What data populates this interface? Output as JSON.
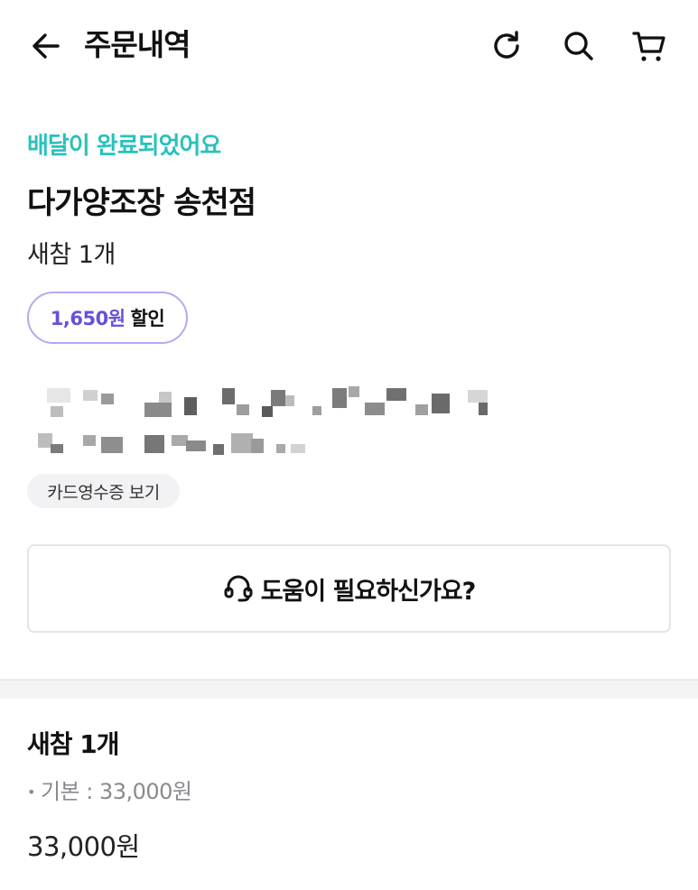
{
  "header": {
    "title": "주문내역",
    "icons": {
      "back": "arrow-left-icon",
      "refresh": "refresh-icon",
      "search": "search-icon",
      "cart": "cart-icon"
    }
  },
  "order": {
    "status": "배달이 완료되었어요",
    "store_name": "다가양조장 송천점",
    "summary": "새참 1개",
    "discount": {
      "amount": "1,650원",
      "label": "할인"
    },
    "receipt_button": "카드영수증 보기"
  },
  "help": {
    "label": "도움이 필요하신가요?",
    "icon": "headset-icon"
  },
  "item": {
    "name": "새참 1개",
    "option": "기본 : 33,000원",
    "price": "33,000원"
  },
  "colors": {
    "status": "#2ac1bc",
    "discount_amount": "#6a4fd8",
    "discount_border": "#b8a7f2"
  }
}
